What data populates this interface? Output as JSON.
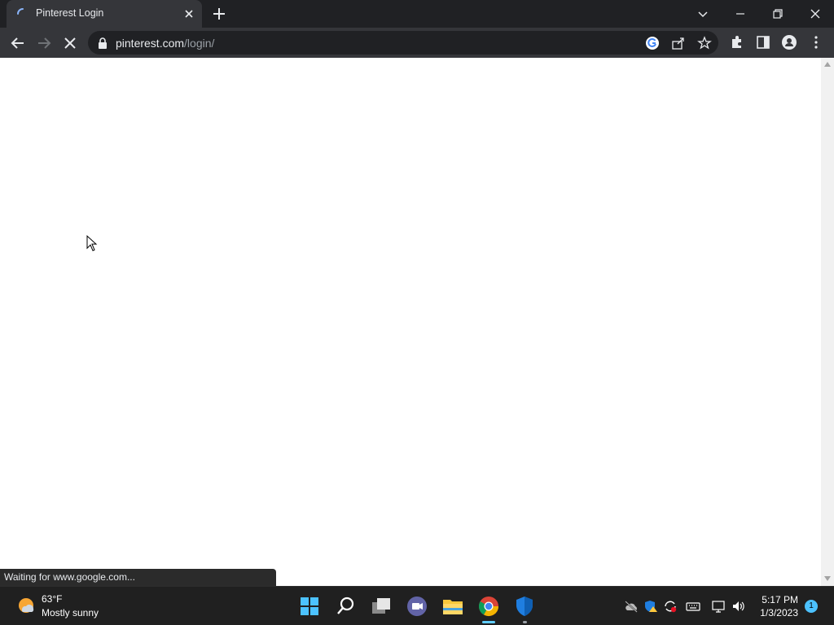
{
  "browser": {
    "tab": {
      "title": "Pinterest Login",
      "loading": true
    },
    "address": {
      "domain": "pinterest.com",
      "path": "/login/"
    },
    "status_text": "Waiting for www.google.com..."
  },
  "taskbar": {
    "weather": {
      "temp": "63°F",
      "desc": "Mostly sunny"
    },
    "clock": {
      "time": "5:17 PM",
      "date": "1/3/2023"
    },
    "notifications": "1",
    "apps": [
      "windows-start",
      "search",
      "task-view",
      "teams-chat",
      "file-explorer",
      "chrome",
      "defender"
    ]
  },
  "colors": {
    "accent": "#60cdff",
    "tab_bg": "#35363a",
    "frame_bg": "#202124"
  }
}
